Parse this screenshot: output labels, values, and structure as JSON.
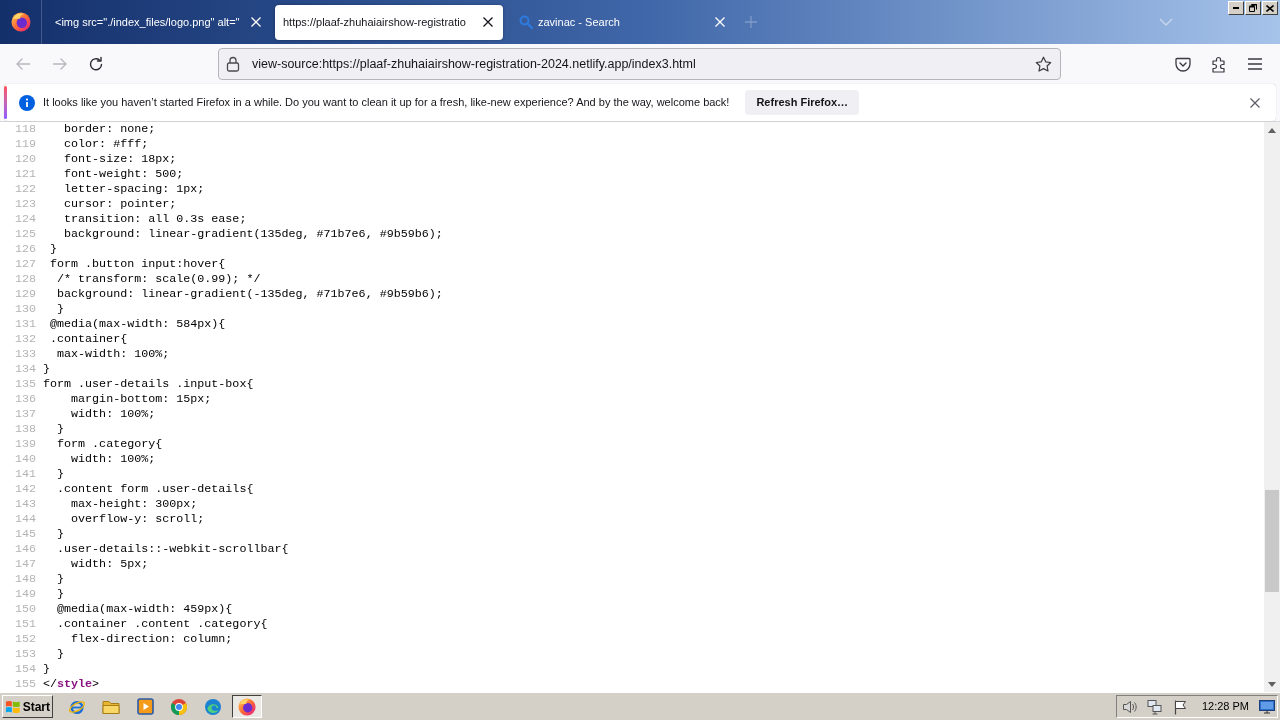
{
  "tabs": [
    {
      "kind": "page",
      "label": "<img src=\"./index_files/logo.png\" alt=\"",
      "selected": false
    },
    {
      "kind": "page",
      "label": "https://plaaf-zhuhaiairshow-registratio",
      "selected": true
    },
    {
      "kind": "search",
      "label": "zavinac - Search",
      "selected": false
    }
  ],
  "nav": {
    "back": {
      "disabled": true
    },
    "forward": {
      "disabled": true
    }
  },
  "address_bar": {
    "value": "view-source:https://plaaf-zhuhaiairshow-registration-2024.netlify.app/index3.html"
  },
  "notification": {
    "message": "It looks like you haven’t started Firefox in a while. Do you want to clean it up for a fresh, like-new experience? And by the way, welcome back!",
    "button": "Refresh Firefox…"
  },
  "source_lines": [
    {
      "number": "118",
      "kind": "css",
      "text": "   border: none;"
    },
    {
      "number": "119",
      "kind": "css",
      "text": "   color: #fff;"
    },
    {
      "number": "120",
      "kind": "css",
      "text": "   font-size: 18px;"
    },
    {
      "number": "121",
      "kind": "css",
      "text": "   font-weight: 500;"
    },
    {
      "number": "122",
      "kind": "css",
      "text": "   letter-spacing: 1px;"
    },
    {
      "number": "123",
      "kind": "css",
      "text": "   cursor: pointer;"
    },
    {
      "number": "124",
      "kind": "css",
      "text": "   transition: all 0.3s ease;"
    },
    {
      "number": "125",
      "kind": "css",
      "text": "   background: linear-gradient(135deg, #71b7e6, #9b59b6);"
    },
    {
      "number": "126",
      "kind": "css",
      "text": " }"
    },
    {
      "number": "127",
      "kind": "css",
      "text": " form .button input:hover{"
    },
    {
      "number": "128",
      "kind": "css",
      "text": "  /* transform: scale(0.99); */"
    },
    {
      "number": "129",
      "kind": "css",
      "text": "  background: linear-gradient(-135deg, #71b7e6, #9b59b6);"
    },
    {
      "number": "130",
      "kind": "css",
      "text": "  }"
    },
    {
      "number": "131",
      "kind": "css",
      "text": " @media(max-width: 584px){"
    },
    {
      "number": "132",
      "kind": "css",
      "text": " .container{"
    },
    {
      "number": "133",
      "kind": "css",
      "text": "  max-width: 100%;"
    },
    {
      "number": "134",
      "kind": "css",
      "text": "}"
    },
    {
      "number": "135",
      "kind": "css",
      "text": "form .user-details .input-box{"
    },
    {
      "number": "136",
      "kind": "css",
      "text": "    margin-bottom: 15px;"
    },
    {
      "number": "137",
      "kind": "css",
      "text": "    width: 100%;"
    },
    {
      "number": "138",
      "kind": "css",
      "text": "  }"
    },
    {
      "number": "139",
      "kind": "css",
      "text": "  form .category{"
    },
    {
      "number": "140",
      "kind": "css",
      "text": "    width: 100%;"
    },
    {
      "number": "141",
      "kind": "css",
      "text": "  }"
    },
    {
      "number": "142",
      "kind": "css",
      "text": "  .content form .user-details{"
    },
    {
      "number": "143",
      "kind": "css",
      "text": "    max-height: 300px;"
    },
    {
      "number": "144",
      "kind": "css",
      "text": "    overflow-y: scroll;"
    },
    {
      "number": "145",
      "kind": "css",
      "text": "  }"
    },
    {
      "number": "146",
      "kind": "css",
      "text": "  .user-details::-webkit-scrollbar{"
    },
    {
      "number": "147",
      "kind": "css",
      "text": "    width: 5px;"
    },
    {
      "number": "148",
      "kind": "css",
      "text": "  }"
    },
    {
      "number": "149",
      "kind": "css",
      "text": "  }"
    },
    {
      "number": "150",
      "kind": "css",
      "text": "  @media(max-width: 459px){"
    },
    {
      "number": "151",
      "kind": "css",
      "text": "  .container .content .category{"
    },
    {
      "number": "152",
      "kind": "css",
      "text": "    flex-direction: column;"
    },
    {
      "number": "153",
      "kind": "css",
      "text": "  }"
    },
    {
      "number": "154",
      "kind": "css",
      "text": "}"
    },
    {
      "number": "155",
      "kind": "markup",
      "open": "</",
      "tag": "style",
      "close": ">"
    }
  ],
  "taskbar": {
    "start": "Start",
    "apps": [
      {
        "kind": "ie",
        "selected": false
      },
      {
        "kind": "folder",
        "selected": false
      },
      {
        "kind": "player",
        "selected": false
      },
      {
        "kind": "chrome",
        "selected": false
      },
      {
        "kind": "edge",
        "selected": false
      },
      {
        "kind": "firefox",
        "selected": true
      }
    ],
    "clock": "12:28 PM"
  }
}
